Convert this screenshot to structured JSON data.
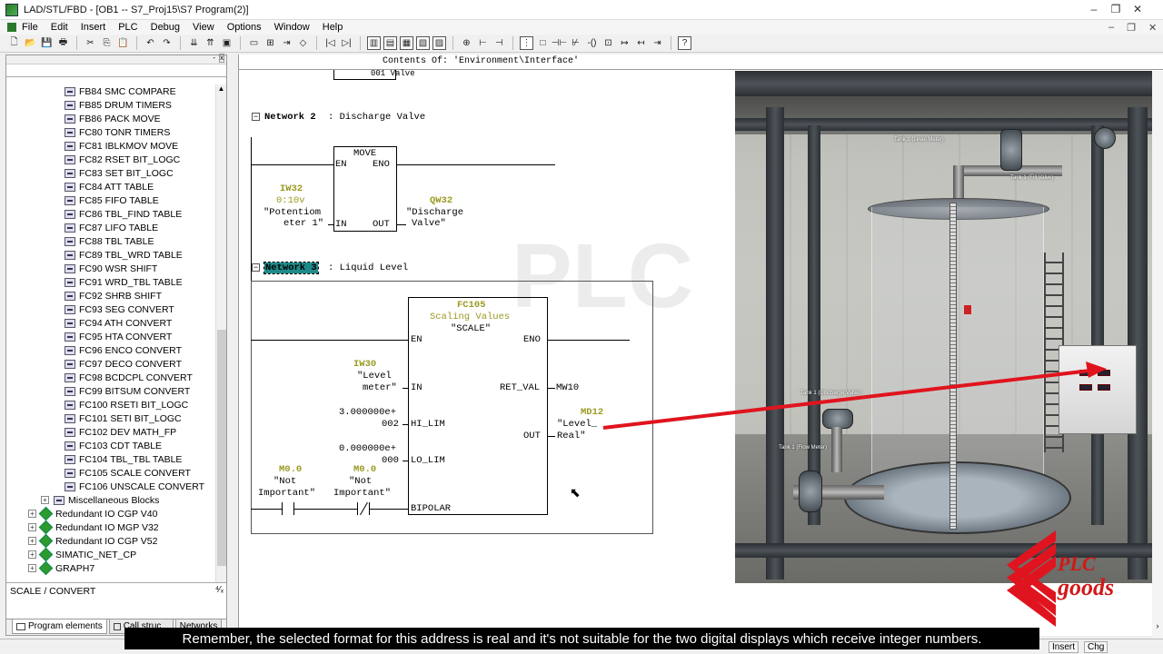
{
  "window": {
    "title": "LAD/STL/FBD  - [OB1 -- S7_Proj15\\S7 Program(2)]",
    "controls": [
      "–",
      "❐",
      "✕"
    ]
  },
  "menu": [
    "File",
    "Edit",
    "Insert",
    "PLC",
    "Debug",
    "View",
    "Options",
    "Window",
    "Help"
  ],
  "tree": {
    "items": [
      {
        "label": "FB84  SMC  COMPARE",
        "type": "fb"
      },
      {
        "label": "FB85  DRUM  TIMERS",
        "type": "fb"
      },
      {
        "label": "FB86  PACK  MOVE",
        "type": "fb"
      },
      {
        "label": "FC80  TONR  TIMERS",
        "type": "fb"
      },
      {
        "label": "FC81  IBLKMOV  MOVE",
        "type": "fb"
      },
      {
        "label": "FC82  RSET  BIT_LOGC",
        "type": "fb"
      },
      {
        "label": "FC83  SET  BIT_LOGC",
        "type": "fb"
      },
      {
        "label": "FC84  ATT  TABLE",
        "type": "fb"
      },
      {
        "label": "FC85  FIFO  TABLE",
        "type": "fb"
      },
      {
        "label": "FC86  TBL_FIND  TABLE",
        "type": "fb"
      },
      {
        "label": "FC87  LIFO  TABLE",
        "type": "fb"
      },
      {
        "label": "FC88  TBL  TABLE",
        "type": "fb"
      },
      {
        "label": "FC89  TBL_WRD  TABLE",
        "type": "fb"
      },
      {
        "label": "FC90  WSR  SHIFT",
        "type": "fb"
      },
      {
        "label": "FC91  WRD_TBL  TABLE",
        "type": "fb"
      },
      {
        "label": "FC92  SHRB  SHIFT",
        "type": "fb"
      },
      {
        "label": "FC93  SEG  CONVERT",
        "type": "fb"
      },
      {
        "label": "FC94  ATH  CONVERT",
        "type": "fb"
      },
      {
        "label": "FC95  HTA  CONVERT",
        "type": "fb"
      },
      {
        "label": "FC96  ENCO  CONVERT",
        "type": "fb"
      },
      {
        "label": "FC97  DECO  CONVERT",
        "type": "fb"
      },
      {
        "label": "FC98  BCDCPL  CONVERT",
        "type": "fb"
      },
      {
        "label": "FC99  BITSUM  CONVERT",
        "type": "fb"
      },
      {
        "label": "FC100  RSETI  BIT_LOGC",
        "type": "fb"
      },
      {
        "label": "FC101  SETI  BIT_LOGC",
        "type": "fb"
      },
      {
        "label": "FC102  DEV  MATH_FP",
        "type": "fb"
      },
      {
        "label": "FC103  CDT  TABLE",
        "type": "fb"
      },
      {
        "label": "FC104  TBL_TBL  TABLE",
        "type": "fb"
      },
      {
        "label": "FC105  SCALE  CONVERT",
        "type": "fb"
      },
      {
        "label": "FC106  UNSCALE  CONVERT",
        "type": "fb"
      },
      {
        "label": "Miscellaneous Blocks",
        "type": "folder"
      },
      {
        "label": "Redundant IO CGP V40",
        "type": "lib"
      },
      {
        "label": "Redundant IO MGP V32",
        "type": "lib"
      },
      {
        "label": "Redundant IO CGP V52",
        "type": "lib"
      },
      {
        "label": "SIMATIC_NET_CP",
        "type": "lib"
      },
      {
        "label": "GRAPH7",
        "type": "lib"
      }
    ],
    "status_text": "SCALE / CONVERT",
    "tabs": [
      "Program elements",
      "Call struc...",
      "Networks"
    ]
  },
  "interface_bar": "Contents Of: 'Environment\\Interface'",
  "network2": {
    "title": "Network 2",
    "comment": ": Discharge Valve",
    "block": "MOVE",
    "en": "EN",
    "eno": "ENO",
    "in": "IN",
    "out": "OUT",
    "in_addr": "IW32",
    "in_range": "0:10v",
    "in_sym1": "\"Potentiom",
    "in_sym2": "eter 1\"",
    "out_addr": "QW32",
    "out_sym1": "\"Discharge",
    "out_sym2": "Valve\"",
    "prev_out": "001 Valve"
  },
  "network3": {
    "title": "Network 3",
    "comment": ": Liquid Level",
    "fc": "FC105",
    "fc_desc": "Scaling Values",
    "fc_name": "\"SCALE\"",
    "en": "EN",
    "eno": "ENO",
    "in": "IN",
    "ret_val": "RET_VAL",
    "hi_lim": "HI_LIM",
    "lo_lim": "LO_LIM",
    "out": "OUT",
    "bipolar": "BIPOLAR",
    "in_addr": "IW30",
    "in_sym1": "\"Level",
    "in_sym2": "meter\"",
    "hi_val1": "3.000000e+",
    "hi_val2": "002",
    "lo_val1": "0.000000e+",
    "lo_val2": "000",
    "ret_addr": "MW10",
    "out_addr": "MD12",
    "out_sym1": "\"Level_",
    "out_sym2": "Real\"",
    "c1_addr": "M0.0",
    "c1_sym1": "\"Not",
    "c1_sym2": "Important\"",
    "c2_addr": "M0.0",
    "c2_sym1": "\"Not",
    "c2_sym2": "Important\""
  },
  "scene": {
    "labels": [
      "Tank 1 (Level Meter)",
      "Tank 1 (Fill Valve)",
      "Tank 1 (Discharge Valve)",
      "Tank 1 (Flow Meter)"
    ]
  },
  "logo": {
    "line1": "PLC",
    "line2": "goods"
  },
  "subtitle": "Remember, the selected format for this address is real and it's not suitable for the two digital displays which receive integer numbers.",
  "statusbar": {
    "mode1": "Insert",
    "mode2": "Chg"
  },
  "colors": {
    "accent_red": "#e0141e",
    "selected_network": "#1f8a8a",
    "symbol_olive": "#9a9a22"
  }
}
